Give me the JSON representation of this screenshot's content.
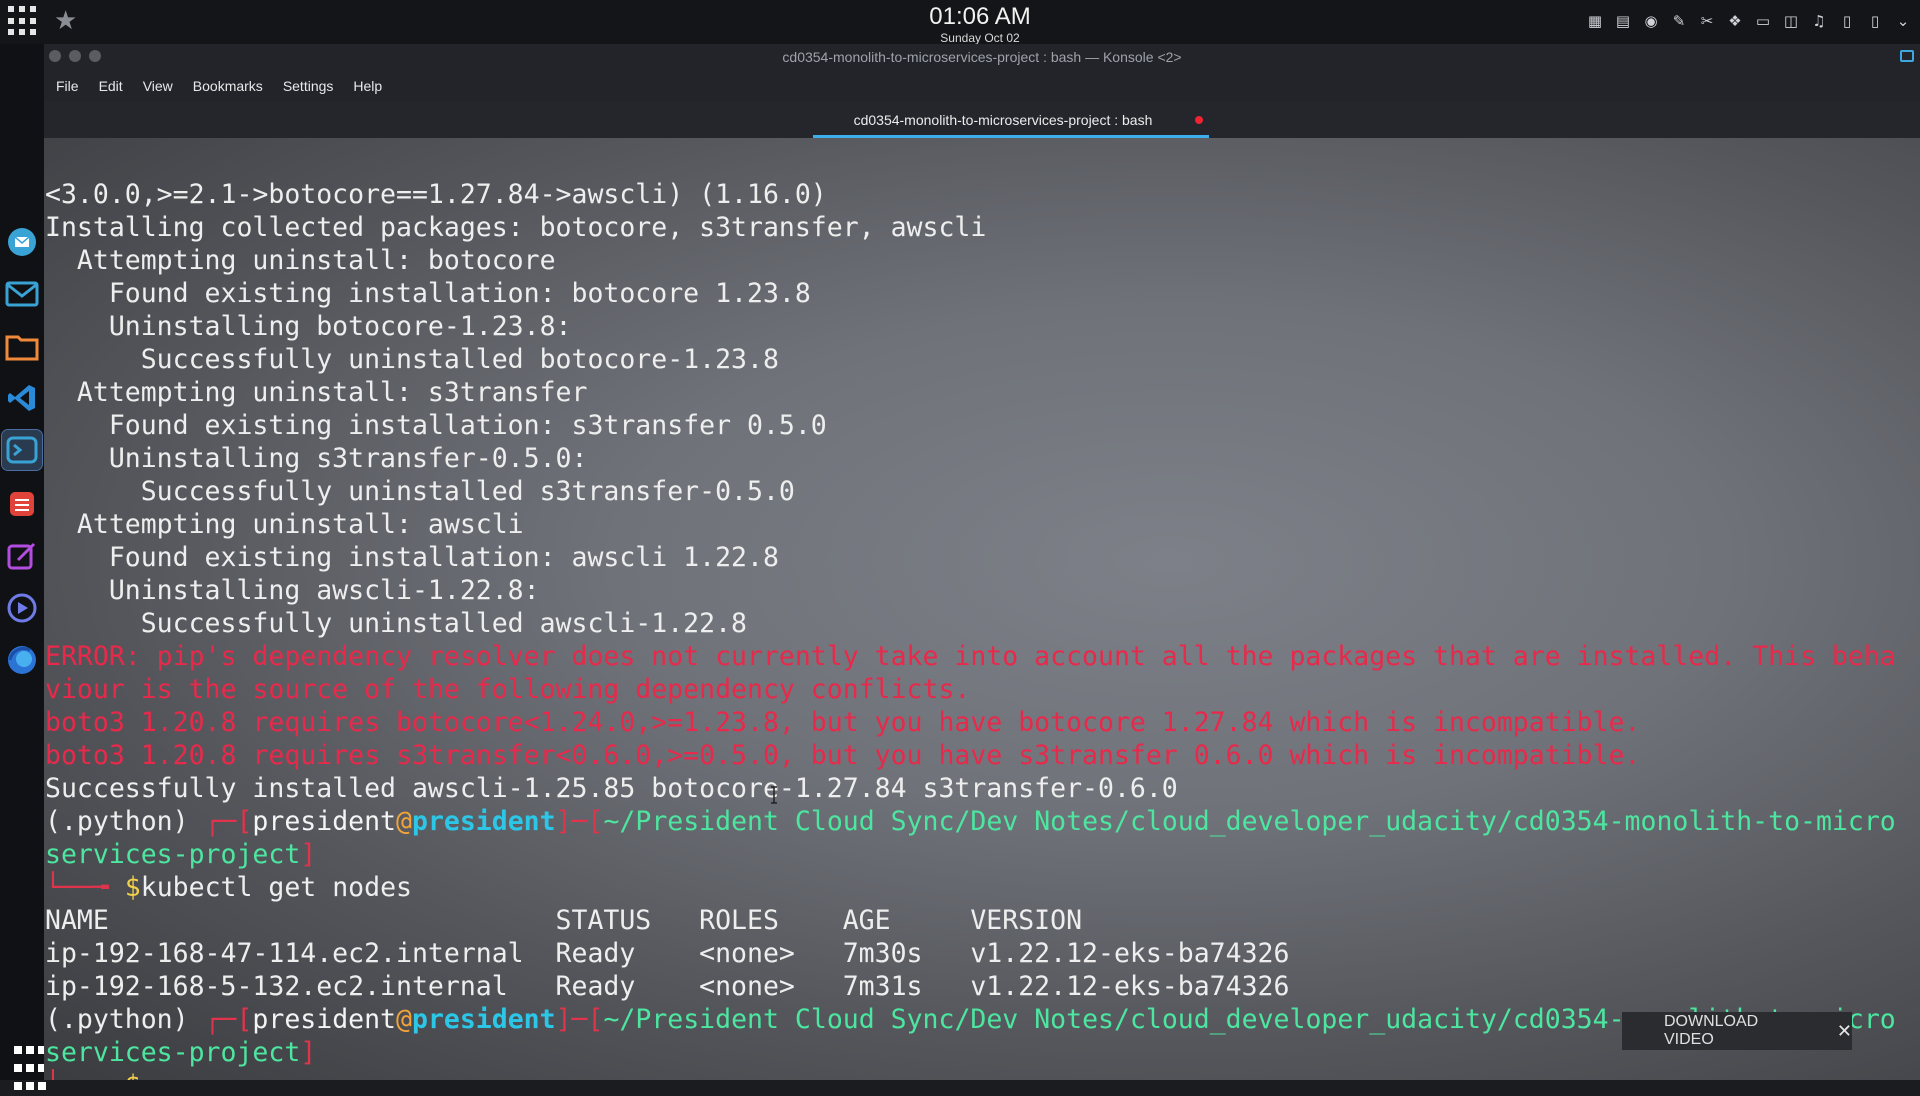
{
  "topbar": {
    "time": "01:06 AM",
    "date": "Sunday Oct 02"
  },
  "window": {
    "title": "cd0354-monolith-to-microservices-project : bash — Konsole <2>",
    "menu": [
      "File",
      "Edit",
      "View",
      "Bookmarks",
      "Settings",
      "Help"
    ],
    "tab_label": "cd0354-monolith-to-microservices-project : bash"
  },
  "terminal": {
    "l01": "<3.0.0,>=2.1->botocore==1.27.84->awscli) (1.16.0)",
    "l02": "Installing collected packages: botocore, s3transfer, awscli",
    "l03": "  Attempting uninstall: botocore",
    "l04": "    Found existing installation: botocore 1.23.8",
    "l05": "    Uninstalling botocore-1.23.8:",
    "l06": "      Successfully uninstalled botocore-1.23.8",
    "l07": "  Attempting uninstall: s3transfer",
    "l08": "    Found existing installation: s3transfer 0.5.0",
    "l09": "    Uninstalling s3transfer-0.5.0:",
    "l10": "      Successfully uninstalled s3transfer-0.5.0",
    "l11": "  Attempting uninstall: awscli",
    "l12": "    Found existing installation: awscli 1.22.8",
    "l13": "    Uninstalling awscli-1.22.8:",
    "l14": "      Successfully uninstalled awscli-1.22.8",
    "l15": "ERROR: pip's dependency resolver does not currently take into account all the packages that are installed. This beha",
    "l16": "viour is the source of the following dependency conflicts.",
    "l17": "boto3 1.20.8 requires botocore<1.24.0,>=1.23.8, but you have botocore 1.27.84 which is incompatible.",
    "l18": "boto3 1.20.8 requires s3transfer<0.6.0,>=0.5.0, but you have s3transfer 0.6.0 which is incompatible.",
    "l19": "Successfully installed awscli-1.25.85 botocore-1.27.84 s3transfer-0.6.0",
    "prompt1": {
      "venv": "(.python) ",
      "open": "┌─[",
      "user": "president",
      "at": "@",
      "host": "president",
      "sep": "]─[",
      "path": "~/President Cloud Sync/Dev Notes/cloud_developer_udacity/cd0354-monolith-to-micro",
      "path2": "services-project",
      "close": "]",
      "arrow": "└──╼ ",
      "dollar": "$",
      "command": "kubectl get nodes"
    },
    "table_header": "NAME                            STATUS   ROLES    AGE     VERSION",
    "table_rows": [
      "ip-192-168-47-114.ec2.internal  Ready    <none>   7m30s   v1.22.12-eks-ba74326",
      "ip-192-168-5-132.ec2.internal   Ready    <none>   7m31s   v1.22.12-eks-ba74326"
    ],
    "prompt2": {
      "venv": "(.python) ",
      "open": "┌─[",
      "user": "president",
      "at": "@",
      "host": "president",
      "sep": "]─[",
      "path": "~/President Cloud Sync/Dev Notes/cloud_developer_udacity/cd0354-monolith-to-micro",
      "path2": "services-project",
      "close": "]",
      "arrow": "└──╼ ",
      "dollar": "$"
    }
  },
  "overlay": {
    "download_label": "DOWNLOAD VIDEO",
    "close_symbol": "✕"
  }
}
